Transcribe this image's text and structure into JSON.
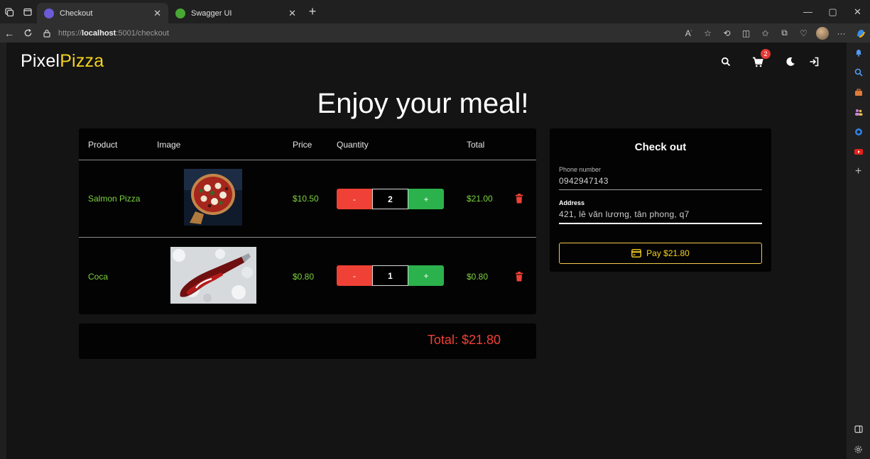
{
  "browser": {
    "tabs": [
      {
        "title": "Checkout",
        "active": true
      },
      {
        "title": "Swagger UI",
        "active": false
      }
    ],
    "url": {
      "scheme": "https://",
      "host": "localhost",
      "rest": ":5001/checkout"
    }
  },
  "app": {
    "brand_primary": "Pixel",
    "brand_accent": "Pizza",
    "cart_count": "2"
  },
  "page": {
    "headline": "Enjoy your meal!"
  },
  "cart": {
    "columns": [
      "Product",
      "Image",
      "Price",
      "Quantity",
      "Total"
    ],
    "items": [
      {
        "product": "Salmon Pizza",
        "price": "$10.50",
        "minus": "-",
        "quantity": "2",
        "plus": "+",
        "total": "$21.00"
      },
      {
        "product": "Coca",
        "price": "$0.80",
        "minus": "-",
        "quantity": "1",
        "plus": "+",
        "total": "$0.80"
      }
    ],
    "grand_total": "Total: $21.80"
  },
  "checkout": {
    "title": "Check out",
    "phone_label": "Phone number",
    "phone_value": "0942947143",
    "address_label": "Address",
    "address_value": "421, lê văn lương, tân phong, q7",
    "pay_label": "Pay $21.80"
  },
  "colors": {
    "brand_accent": "#f5d21e",
    "item_text": "#7cd23f",
    "minus_button": "#ef4136",
    "plus_button": "#2bb24c",
    "total_text": "#ef4136",
    "badge": "#e53935"
  }
}
